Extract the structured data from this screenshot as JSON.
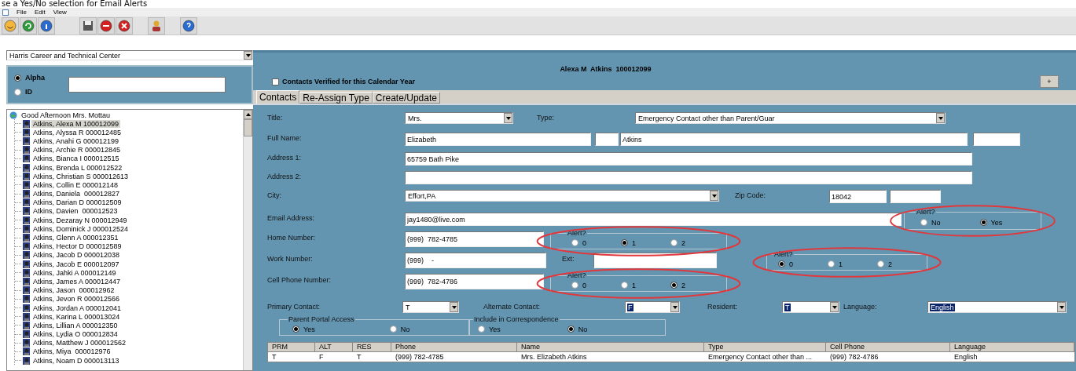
{
  "heading": "se a Yes/No selection for Email Alerts",
  "menu": [
    "File",
    "Edit",
    "View"
  ],
  "school": "Harris Career and Technical Center",
  "search": {
    "options": [
      {
        "label": "Alpha",
        "selected": true
      },
      {
        "label": "ID",
        "selected": false
      }
    ]
  },
  "tree": {
    "label": "Good Afternoon Mrs. Mottau",
    "children": [
      {
        "label": "Atkins, Alexa M 100012099",
        "selected": true
      },
      {
        "label": "Atkins, Alyssa R 000012485",
        "selected": false
      },
      {
        "label": "Atkins, Anahi G 000012199",
        "selected": false
      },
      {
        "label": "Atkins, Archie R 000012845",
        "selected": false
      },
      {
        "label": "Atkins, Bianca I 000012515",
        "selected": false
      },
      {
        "label": "Atkins, Brenda L 000012522",
        "selected": false
      },
      {
        "label": "Atkins, Christian S 000012613",
        "selected": false
      },
      {
        "label": "Atkins, Collin E 000012148",
        "selected": false
      },
      {
        "label": "Atkins, Daniela  000012827",
        "selected": false
      },
      {
        "label": "Atkins, Darian D 000012509",
        "selected": false
      },
      {
        "label": "Atkins, Davien  000012523",
        "selected": false
      },
      {
        "label": "Atkins, Dezaray N 000012949",
        "selected": false
      },
      {
        "label": "Atkins, Dominick J 000012524",
        "selected": false
      },
      {
        "label": "Atkins, Glenn A 000012351",
        "selected": false
      },
      {
        "label": "Atkins, Hector D 000012589",
        "selected": false
      },
      {
        "label": "Atkins, Jacob D 000012038",
        "selected": false
      },
      {
        "label": "Atkins, Jacob E 000012097",
        "selected": false
      },
      {
        "label": "Atkins, Jahki A 000012149",
        "selected": false
      },
      {
        "label": "Atkins, James A 000012447",
        "selected": false
      },
      {
        "label": "Atkins, Jason  000012962",
        "selected": false
      },
      {
        "label": "Atkins, Jevon R 000012566",
        "selected": false
      },
      {
        "label": "Atkins, Jordan A 000012041",
        "selected": false
      },
      {
        "label": "Atkins, Karina L 000013024",
        "selected": false
      },
      {
        "label": "Atkins, Lillian A 000012350",
        "selected": false
      },
      {
        "label": "Atkins, Lydia O 000012834",
        "selected": false
      },
      {
        "label": "Atkins, Matthew J 000012562",
        "selected": false
      },
      {
        "label": "Atkins, Miya  000012976",
        "selected": false
      },
      {
        "label": "Atkins, Noam D 000013113",
        "selected": false
      }
    ]
  },
  "student": "Alexa M  Atkins  100012099",
  "verified": {
    "label": "Contacts Verified for this Calendar Year",
    "checked": false
  },
  "add_button": "+",
  "tabs": [
    {
      "label": "Contacts",
      "selected": true
    },
    {
      "label": "Re-Assign Type",
      "selected": false
    },
    {
      "label": "Create/Update",
      "selected": false
    }
  ],
  "form": {
    "title": {
      "label": "Title:",
      "value": "Mrs."
    },
    "type": {
      "label": "Type:",
      "value": "Emergency Contact other than Parent/Guar"
    },
    "full_name": {
      "label": "Full Name:",
      "first": "Elizabeth",
      "last": "Atkins"
    },
    "address1": {
      "label": "Address 1:",
      "value": "65759 Bath Pike"
    },
    "address2": {
      "label": "Address 2:"
    },
    "city": {
      "label": "City:",
      "value": "Effort,PA"
    },
    "zip": {
      "label": "Zip Code:",
      "value": "18042"
    },
    "email": {
      "label": "Email Address:",
      "value": "jay1480@live.com",
      "alert": {
        "legend": "Alert?",
        "highlighted": true,
        "options": [
          {
            "label": "No",
            "selected": false
          },
          {
            "label": "Yes",
            "selected": true
          }
        ]
      }
    },
    "home": {
      "label": "Home Number:",
      "value": "(999)  782-4785",
      "alert": {
        "legend": "Alert?",
        "highlighted": true,
        "options": [
          {
            "label": "0",
            "selected": false
          },
          {
            "label": "1",
            "selected": true
          },
          {
            "label": "2",
            "selected": false
          }
        ]
      }
    },
    "work": {
      "label": "Work Number:",
      "value": "(999)    -",
      "ext_label": "Ext:",
      "alert": {
        "legend": "Alert?",
        "highlighted": true,
        "options": [
          {
            "label": "0",
            "selected": true
          },
          {
            "label": "1",
            "selected": false
          },
          {
            "label": "2",
            "selected": false
          }
        ]
      }
    },
    "cell": {
      "label": "Cell Phone Number:",
      "value": "(999)  782-4786",
      "alert": {
        "legend": "Alert?",
        "highlighted": true,
        "options": [
          {
            "label": "0",
            "selected": false
          },
          {
            "label": "1",
            "selected": false
          },
          {
            "label": "2",
            "selected": true
          }
        ]
      }
    },
    "primary": {
      "label": "Primary Contact:",
      "value": "T",
      "text_selected": false
    },
    "alternate": {
      "label": "Alternate Contact:",
      "value": "F",
      "text_selected": true
    },
    "resident": {
      "label": "Resident:",
      "value": "T",
      "text_selected": true
    },
    "language": {
      "label": "Language:",
      "value": "English",
      "text_selected": true
    },
    "portal": {
      "legend": "Parent Portal Access",
      "options": [
        {
          "label": "Yes",
          "selected": true
        },
        {
          "label": "No",
          "selected": false
        }
      ]
    },
    "correspondence": {
      "legend": "Include in Correspondence",
      "options": [
        {
          "label": "Yes",
          "selected": false
        },
        {
          "label": "No",
          "selected": true
        }
      ]
    }
  },
  "table": {
    "columns": [
      "PRM",
      "ALT",
      "RES",
      "Phone",
      "Name",
      "Type",
      "Cell Phone",
      "Language"
    ],
    "rows": [
      [
        "T",
        "F",
        "T",
        "(999) 782-4785",
        "Mrs. Elizabeth  Atkins",
        "Emergency Contact other than ...",
        "(999) 782-4786",
        "English"
      ]
    ]
  }
}
